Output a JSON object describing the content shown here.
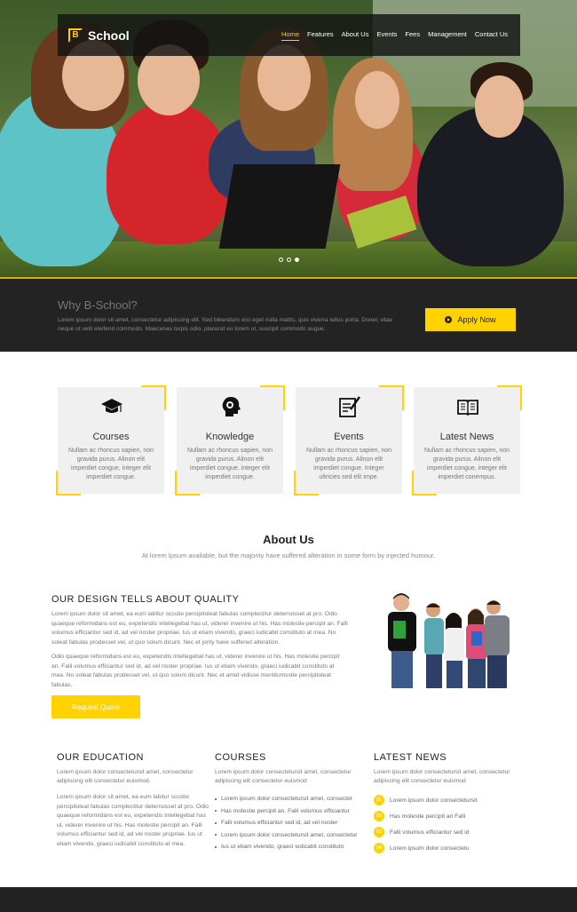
{
  "brand": {
    "logo_letter": "B",
    "name": "School"
  },
  "nav": {
    "items": [
      {
        "label": "Home",
        "active": true
      },
      {
        "label": "Features",
        "active": false
      },
      {
        "label": "About Us",
        "active": false
      },
      {
        "label": "Events",
        "active": false
      },
      {
        "label": "Fees",
        "active": false
      },
      {
        "label": "Management",
        "active": false
      },
      {
        "label": "Contact Us",
        "active": false
      }
    ]
  },
  "slider": {
    "slide_count": 3,
    "active_index": 2
  },
  "why": {
    "title": "Why B-School?",
    "text": "Lorem ipsum dolor sit amet, consectetur adipiscing elit. Sed bibendum orci eget nulla mattis, quis viverra tellus porta. Donec vitae neque ut velit eleifend commodo. Maecenas turpis odio, placerat eu lorem ut, suscipit commodo augue.",
    "apply_label": "Apply Now"
  },
  "features": [
    {
      "title": "Courses",
      "icon": "graduation-cap-icon",
      "text": "Nullam ac rhoncus sapien, non gravida purus. Alinon elit imperdiet congue, integer elit imperdiet congue."
    },
    {
      "title": "Knowledge",
      "icon": "brain-head-icon",
      "text": "Nullam ac rhoncus sapien, non gravida purus. Alinon elit imperdiet congue, integer elit imperdiet congue."
    },
    {
      "title": "Events",
      "icon": "checklist-pen-icon",
      "text": "Nullam ac rhoncus sapien, non gravida purus. Alinon elit imperdiet congue. Integer ultricies sed elit impe."
    },
    {
      "title": "Latest News",
      "icon": "open-book-icon",
      "text": "Nullam ac rhoncus sapien, non gravida purus. Alinon elit imperdiet congue, integer elit imperdiet conempus."
    }
  ],
  "about": {
    "title": "About Us",
    "subtitle": "At lorem Ipsum available, but the majority have suffered alteration in some form by injected humour."
  },
  "quality": {
    "title": "OUR DESIGN TELLS ABOUT QUALITY",
    "p1": "Lorem ipsum dolor sit amet, ea eum labitur scsstie percipitoleat fabulas complectitur deterruisset at pro. Odio quaeque reformidans est eu, expetendis intellegebat has ut, viderer invenire ut his. Has molestie percipit an. Falli volumus efficiantur sed id, ad vel noster propriae. Ius ut etiam vivendo, graeci iudicabit constituto at mea. No soleat fabulas prodesset vel, ut quo solum dicunt. Nec et jority have suffered alteration.",
    "p2": "Odio quaeque reformidans est eu, expetendis intellegebat has ut, viderer invenire ut his. Has molestie percipit an. Falli volumus efficiantur sed id, ad vel noster propriae. Ius ut etiam vivendo, graeci iudicabit constituto at mea. No soleat fabulas prodesset vel, ut quo solum dicunt. Nec et amet vidisse mentitumsstie percipitoleat fabulas.",
    "button_label": "Request Quote"
  },
  "education": {
    "title": "OUR EDUCATION",
    "lead": "Lorem ipsum dolor consectetursit amet, consectetur adipiscing elit consectetur euismod.",
    "body": "Lorem ipsum dolor sit amet, ea eum labitur scsstie percipitoleat fabulas complectitur deterruisset at pro. Odio quaeque reformidans est eu, expetendis intellegebat has ut, viderer invenire ut his. Has molestie percipit an. Falli volumus efficiantur sed id, ad vel noster propriae. Ius ut etiam vivendo, graeci iudicabit constituto at mea."
  },
  "courses": {
    "title": "COURSES",
    "lead": "Lorem ipsum dolor consectetursit amet, consectetur adipiscing elit consectetur euismod",
    "items": [
      "Lorem ipsum dolor consectetursit amet, consectet",
      "Has molestie percipit an. Falli volumus efficiantur",
      "Falli volumus efficiantur sed id, ad vel noster",
      "Lorem ipsum dolor consectetursit amet, consectetur",
      "Ius ut etiam vivendo, graeci iudicabit constituto"
    ]
  },
  "news": {
    "title": "LATEST NEWS",
    "lead": "Lorem ipsum dolor consectetursit amet, consectetur adipiscing elit consectetur euismod",
    "items": [
      {
        "num": "01",
        "text": "Lorem ipsum dolor consectetursit"
      },
      {
        "num": "02",
        "text": "Has molestie percipit an Falli"
      },
      {
        "num": "03",
        "text": "Falli volumus efficiantur sed id"
      },
      {
        "num": "04",
        "text": "Lorem ipsum dolor consectetu"
      }
    ]
  },
  "colors": {
    "accent": "#ffd200",
    "dark": "#232323",
    "card": "#f0f0f0"
  }
}
